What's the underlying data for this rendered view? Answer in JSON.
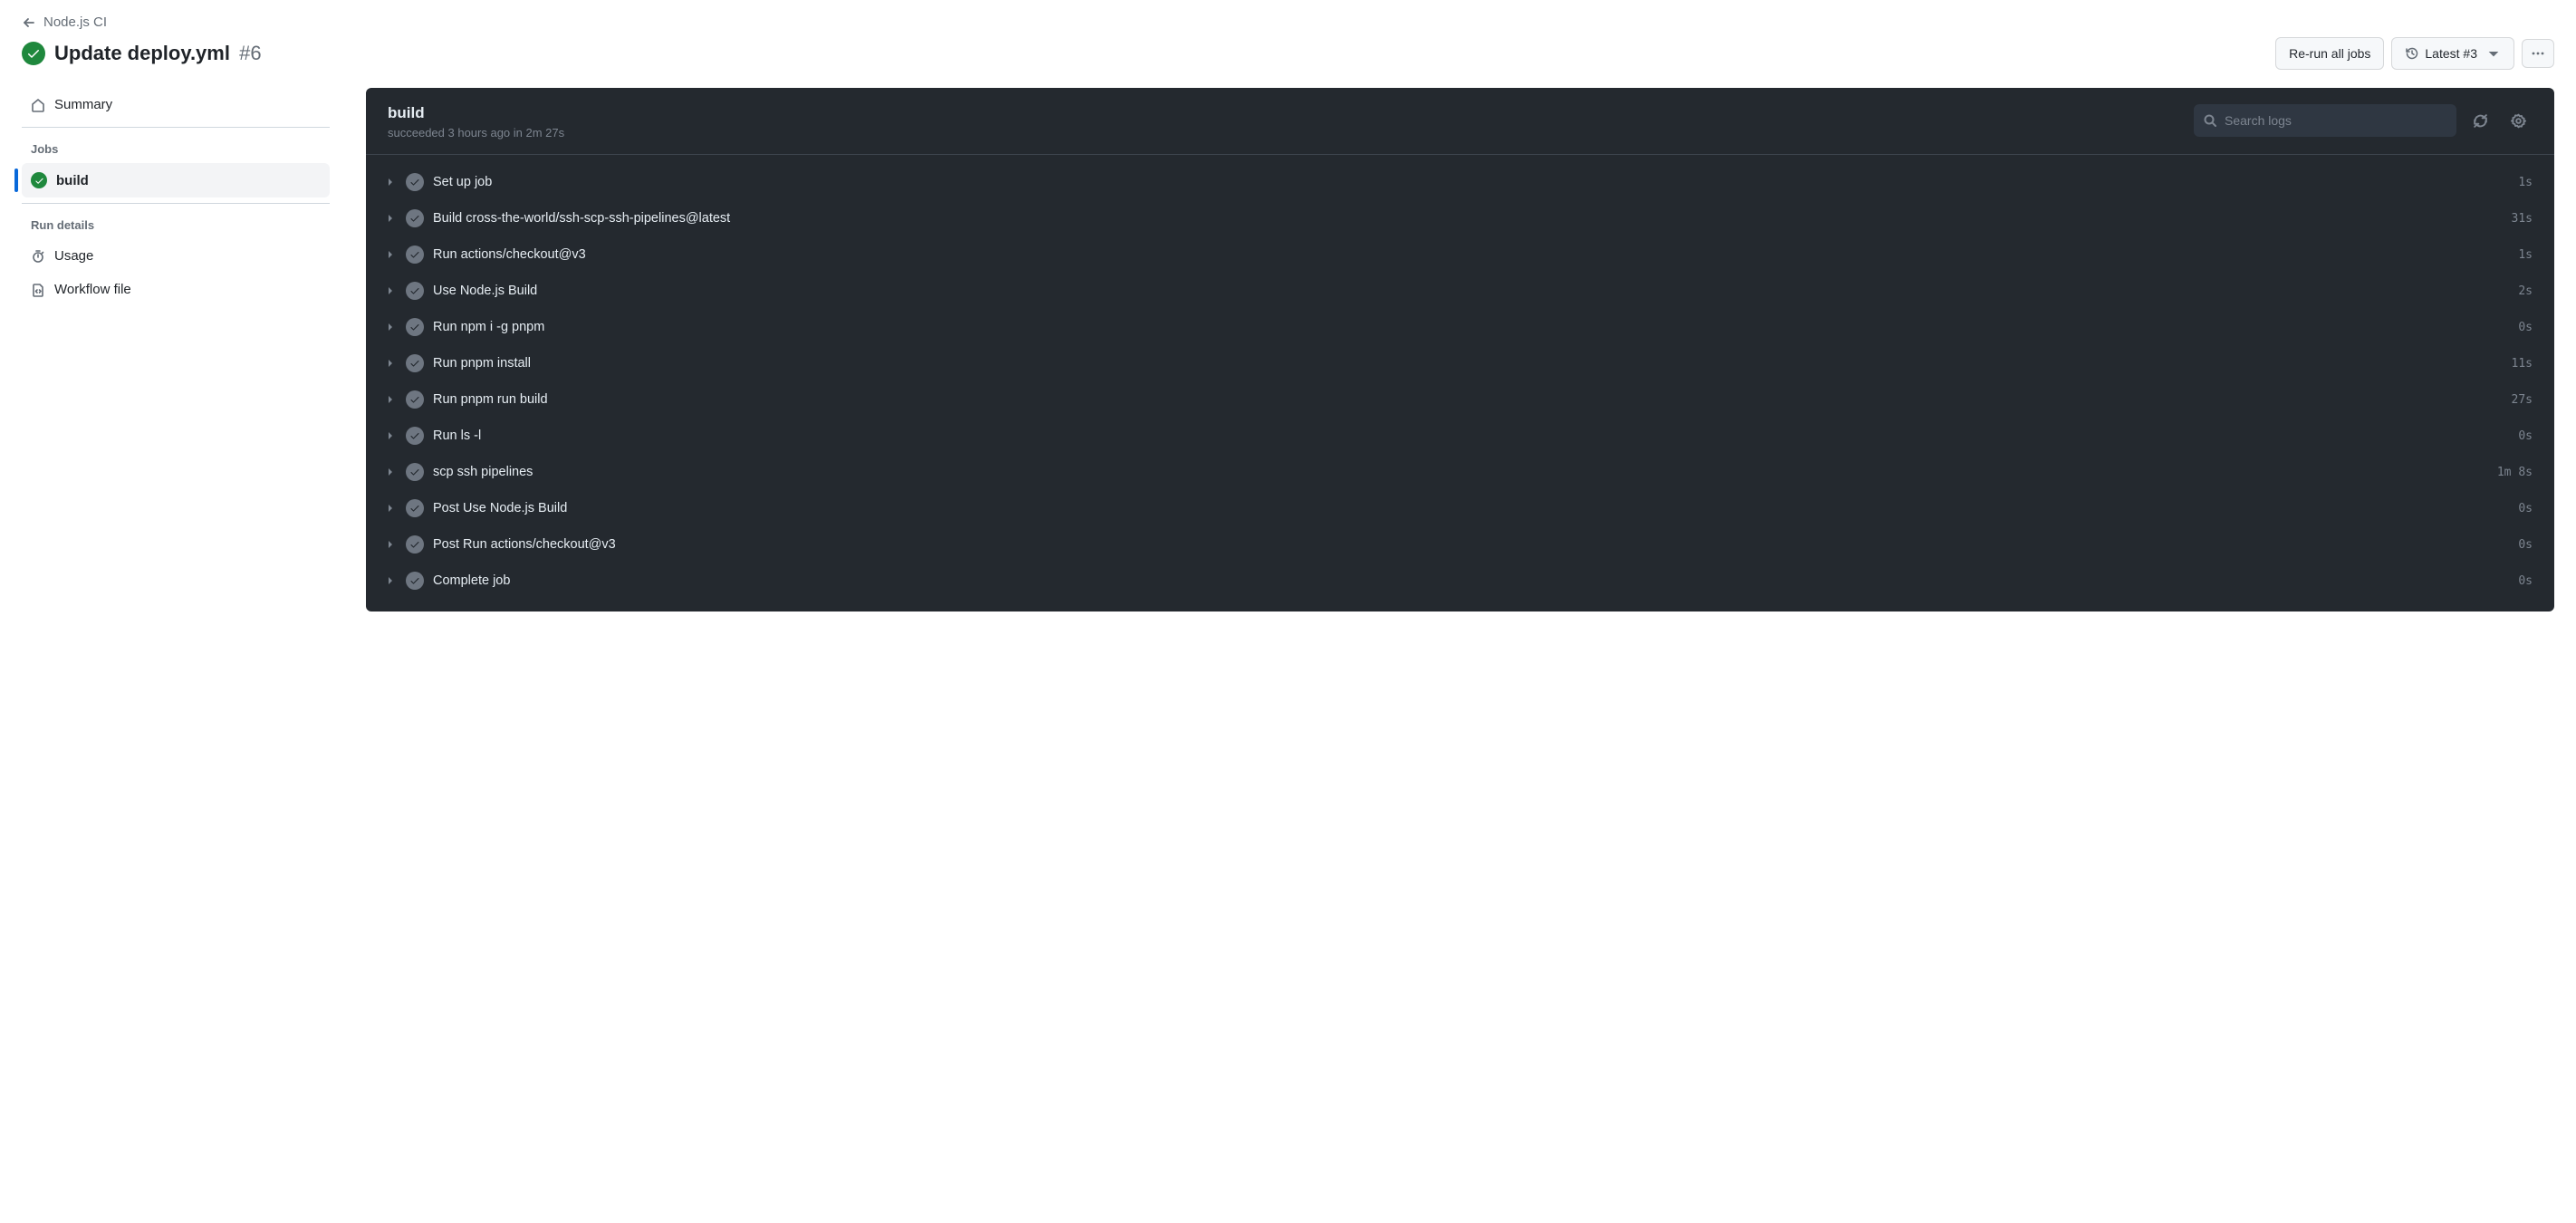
{
  "nav": {
    "back_label": "Node.js CI"
  },
  "run": {
    "status": "success",
    "title": "Update deploy.yml",
    "number": "#6"
  },
  "actions": {
    "rerun_label": "Re-run all jobs",
    "latest_label": "Latest #3"
  },
  "sidebar": {
    "summary_label": "Summary",
    "jobs_heading": "Jobs",
    "run_details_heading": "Run details",
    "usage_label": "Usage",
    "workflow_file_label": "Workflow file",
    "jobs": [
      {
        "name": "build",
        "status": "success",
        "selected": true
      }
    ]
  },
  "job": {
    "name": "build",
    "substatus": "succeeded 3 hours ago in 2m 27s"
  },
  "search": {
    "placeholder": "Search logs"
  },
  "steps": [
    {
      "label": "Set up job",
      "duration": "1s"
    },
    {
      "label": "Build cross-the-world/ssh-scp-ssh-pipelines@latest",
      "duration": "31s"
    },
    {
      "label": "Run actions/checkout@v3",
      "duration": "1s"
    },
    {
      "label": "Use Node.js Build",
      "duration": "2s"
    },
    {
      "label": "Run npm i -g pnpm",
      "duration": "0s"
    },
    {
      "label": "Run pnpm install",
      "duration": "11s"
    },
    {
      "label": "Run pnpm run build",
      "duration": "27s"
    },
    {
      "label": "Run ls -l",
      "duration": "0s"
    },
    {
      "label": "scp ssh pipelines",
      "duration": "1m 8s"
    },
    {
      "label": "Post Use Node.js Build",
      "duration": "0s"
    },
    {
      "label": "Post Run actions/checkout@v3",
      "duration": "0s"
    },
    {
      "label": "Complete job",
      "duration": "0s"
    }
  ]
}
